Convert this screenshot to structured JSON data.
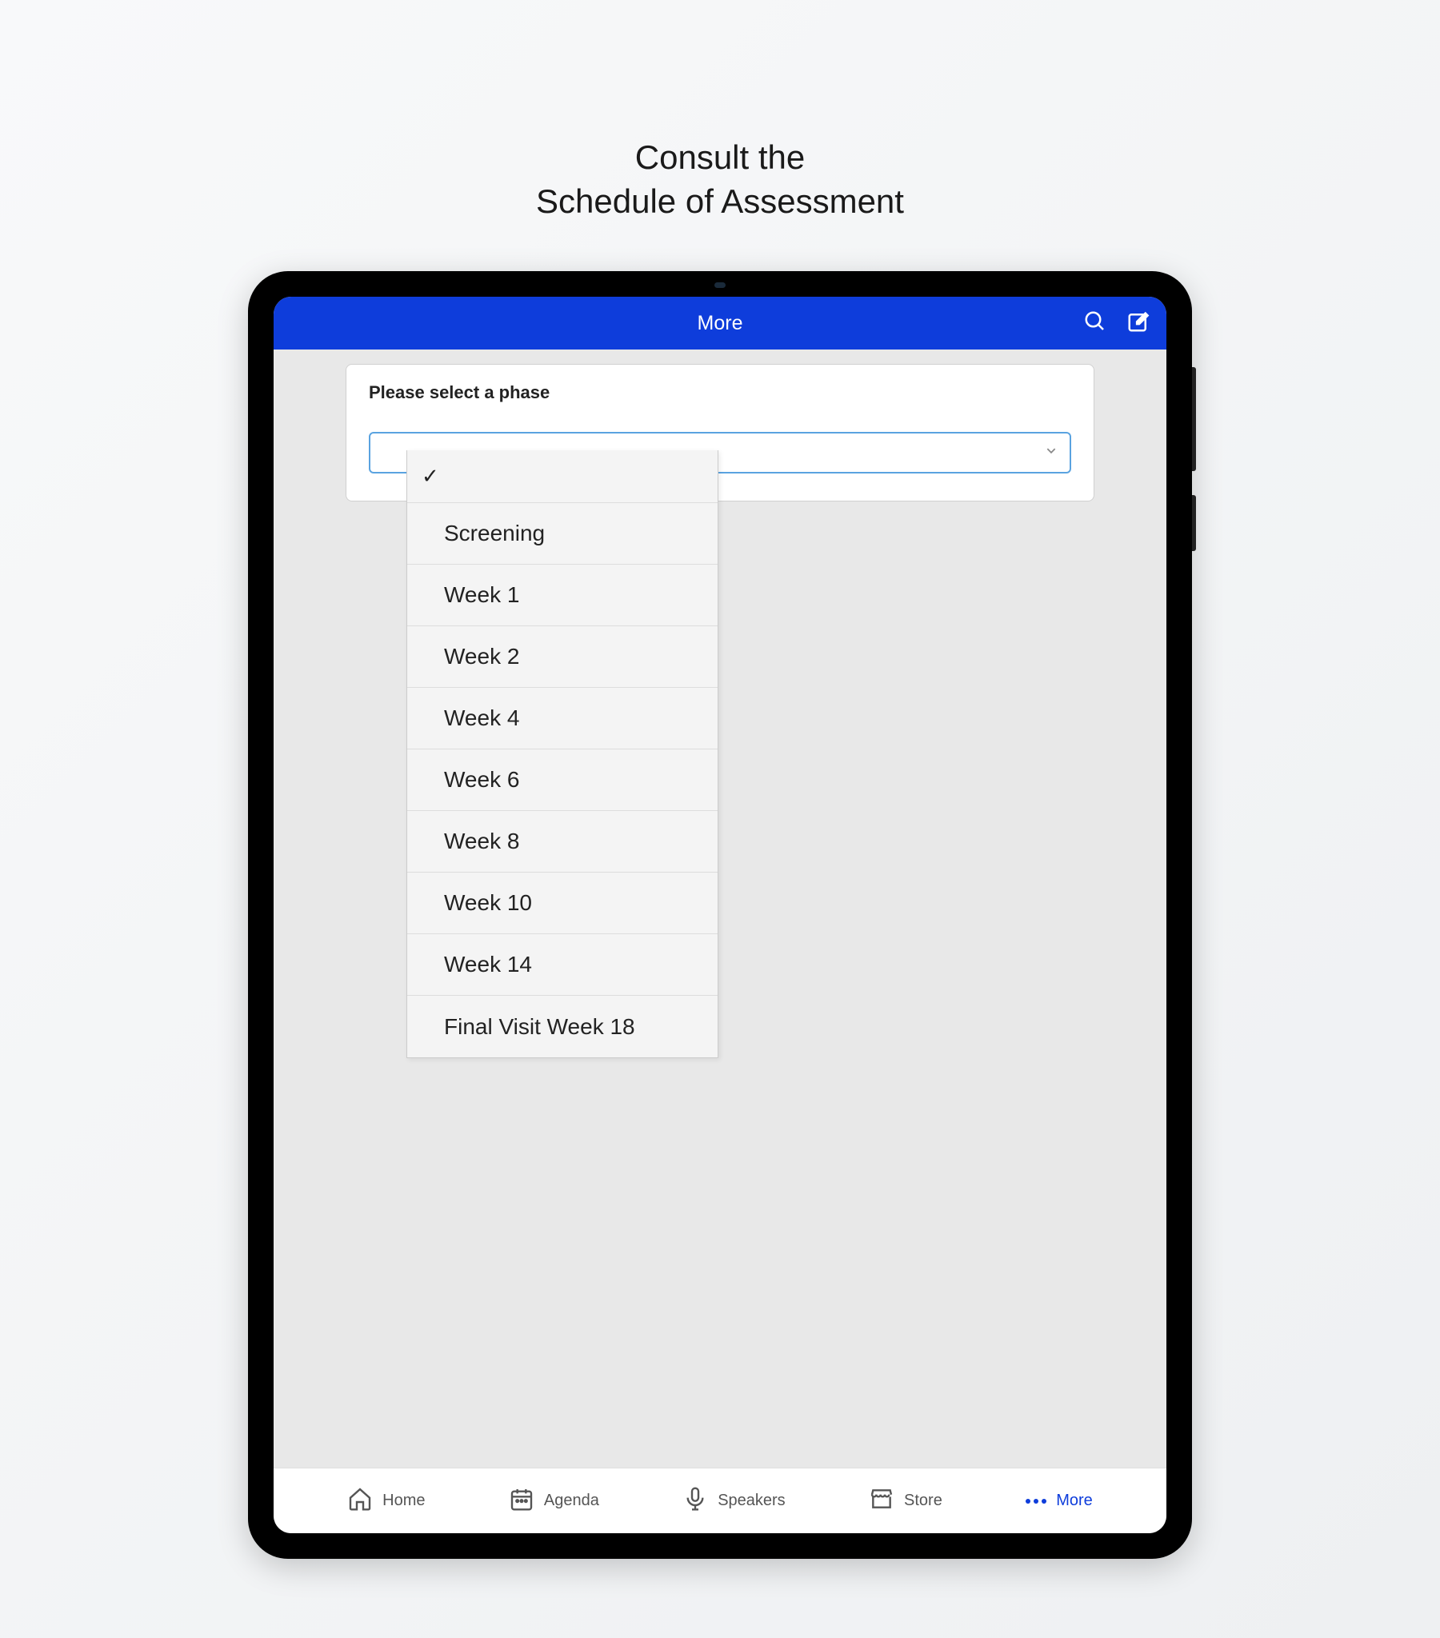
{
  "promo": {
    "line1": "Consult the",
    "line2": "Schedule of Assessment"
  },
  "topBar": {
    "title": "More"
  },
  "form": {
    "label": "Please select a phase"
  },
  "dropdown": {
    "selected": "",
    "items": [
      "Screening",
      "Week 1",
      "Week 2",
      "Week 4",
      "Week 6",
      "Week 8",
      "Week 10",
      "Week 14",
      "Final Visit Week 18"
    ]
  },
  "nav": {
    "home": "Home",
    "agenda": "Agenda",
    "speakers": "Speakers",
    "store": "Store",
    "more": "More"
  }
}
